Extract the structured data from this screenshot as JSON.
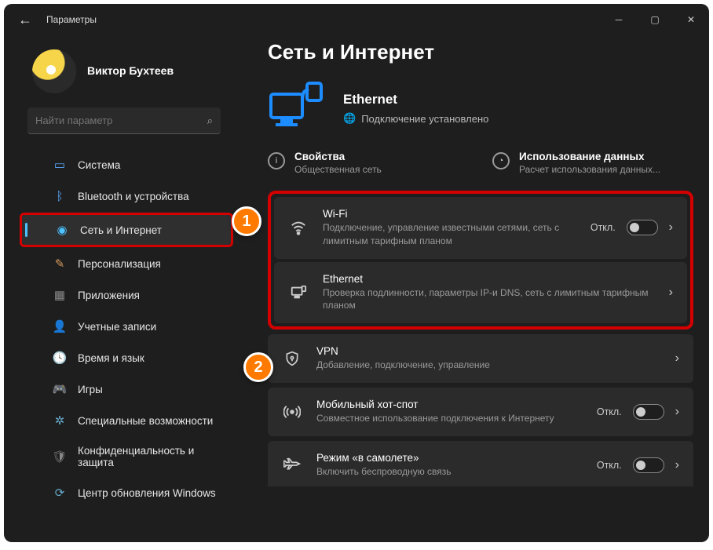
{
  "window": {
    "title": "Параметры"
  },
  "profile": {
    "name": "Виктор Бухтеев",
    "sub": " "
  },
  "search": {
    "placeholder": "Найти параметр"
  },
  "nav": {
    "system": "Система",
    "bluetooth": "Bluetooth и устройства",
    "network": "Сеть и Интернет",
    "personalization": "Персонализация",
    "apps": "Приложения",
    "accounts": "Учетные записи",
    "time": "Время и язык",
    "gaming": "Игры",
    "accessibility": "Специальные возможности",
    "privacy": "Конфиденциальность и защита",
    "update": "Центр обновления Windows"
  },
  "page": {
    "title": "Сеть и Интернет",
    "conn_name": "Ethernet",
    "conn_status": "Подключение установлено",
    "props": {
      "h": "Свойства",
      "s": "Общественная сеть"
    },
    "usage": {
      "h": "Использование данных",
      "s": "Расчет использования данных..."
    }
  },
  "cards": {
    "wifi": {
      "h": "Wi-Fi",
      "s": "Подключение, управление известными сетями, сеть с лимитным тарифным планом",
      "state": "Откл."
    },
    "ethernet": {
      "h": "Ethernet",
      "s": "Проверка подлинности, параметры IP-и DNS, сеть с лимитным тарифным планом"
    },
    "vpn": {
      "h": "VPN",
      "s": "Добавление, подключение, управление"
    },
    "hotspot": {
      "h": "Мобильный хот-спот",
      "s": "Совместное использование подключения к Интернету",
      "state": "Откл."
    },
    "airplane": {
      "h": "Режим «в самолете»",
      "s": "Включить беспроводную связь",
      "state": "Откл."
    }
  },
  "badges": {
    "one": "1",
    "two": "2"
  }
}
